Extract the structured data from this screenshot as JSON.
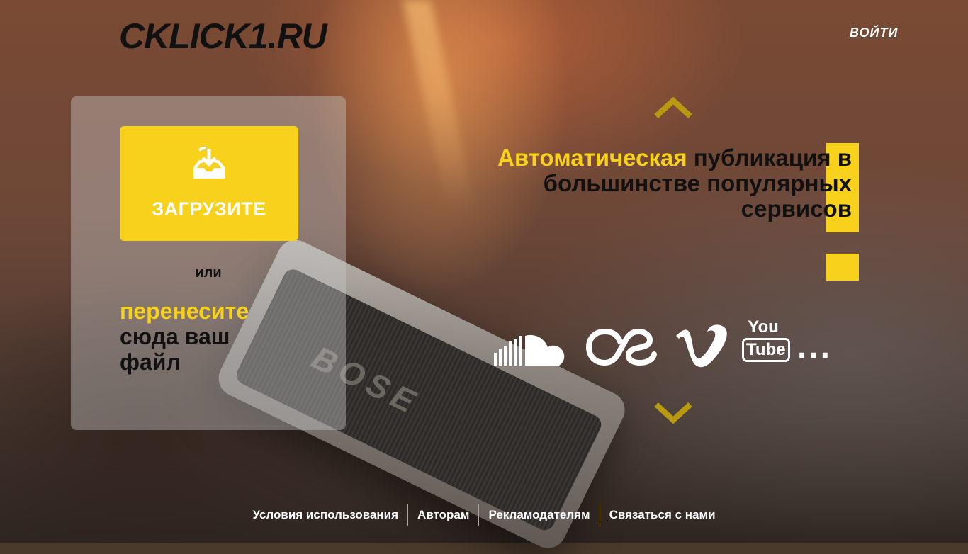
{
  "header": {
    "logo": "CKLICK1.RU",
    "login_label": "ВОЙТИ"
  },
  "upload": {
    "button_label": "ЗАГРУЗИТЕ",
    "icon": "upload-tray-icon",
    "or_label": "или",
    "drop_accent": "перенесите",
    "drop_rest": "сюда ваш файл"
  },
  "promo": {
    "headline_accent": "Автоматическая",
    "headline_rest": " публикация в большинстве популярных сервисов",
    "prev_icon": "chevron-up-icon",
    "next_icon": "chevron-down-icon"
  },
  "services": {
    "items": [
      "soundcloud-icon",
      "lastfm-icon",
      "vimeo-icon",
      "youtube-icon"
    ],
    "youtube_you": "You",
    "youtube_tube": "Tube",
    "more_label": "..."
  },
  "background": {
    "speaker_brand": "BOSE"
  },
  "footer": {
    "links": [
      "Условия использования",
      "Авторам",
      "Рекламодателям",
      "Связаться с нами"
    ]
  },
  "colors": {
    "accent": "#f7d11b",
    "text_dark": "#111111",
    "text_light": "#ffffff"
  }
}
